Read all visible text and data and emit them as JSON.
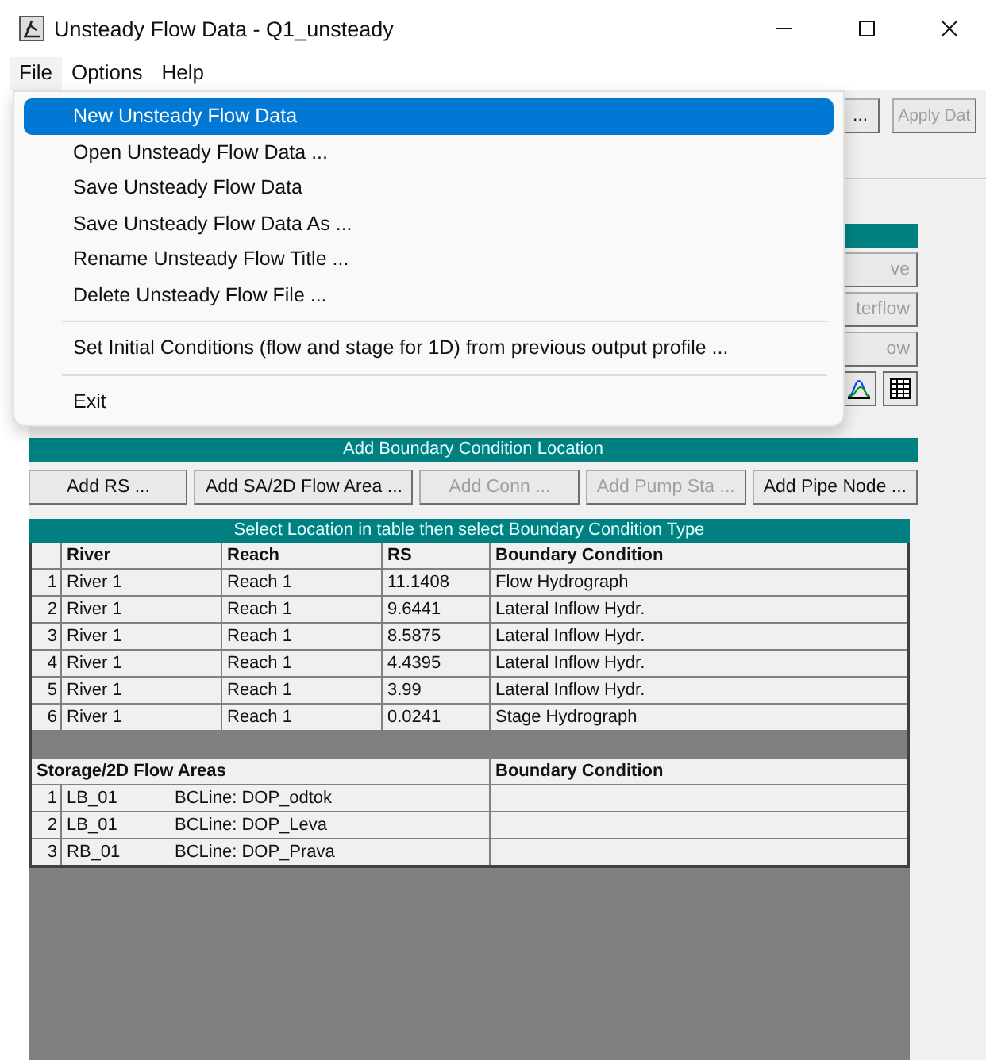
{
  "window": {
    "title": "Unsteady Flow Data - Q1_unsteady"
  },
  "menu_bar": [
    {
      "label": "File",
      "selected": true
    },
    {
      "label": "Options",
      "selected": false
    },
    {
      "label": "Help",
      "selected": false
    }
  ],
  "file_menu": [
    {
      "kind": "item",
      "label": "New Unsteady Flow Data",
      "selected": true
    },
    {
      "kind": "item",
      "label": "Open Unsteady Flow Data ...",
      "selected": false
    },
    {
      "kind": "item",
      "label": "Save Unsteady Flow Data",
      "selected": false
    },
    {
      "kind": "item",
      "label": "Save Unsteady Flow Data As ...",
      "selected": false
    },
    {
      "kind": "item",
      "label": "Rename Unsteady Flow Title ...",
      "selected": false
    },
    {
      "kind": "item",
      "label": "Delete Unsteady Flow File ...",
      "selected": false
    },
    {
      "kind": "separator"
    },
    {
      "kind": "item",
      "label": "Set Initial Conditions (flow and stage for 1D) from previous output profile ...",
      "selected": false
    },
    {
      "kind": "separator"
    },
    {
      "kind": "item",
      "label": "Exit",
      "selected": false
    }
  ],
  "toolbar_buttons": [
    {
      "label": "...",
      "disabled": false
    },
    {
      "label": "Apply Dat",
      "disabled": true
    }
  ],
  "side_buttons": [
    {
      "label": "ve",
      "disabled": true
    },
    {
      "label": "terflow",
      "disabled": true
    },
    {
      "label": "ow",
      "disabled": true
    }
  ],
  "boundary_location": {
    "title": "Add Boundary Condition Location",
    "buttons": [
      {
        "label": "Add RS ...",
        "disabled": false
      },
      {
        "label": "Add SA/2D Flow Area ...",
        "disabled": false
      },
      {
        "label": "Add Conn ...",
        "disabled": true
      },
      {
        "label": "Add Pump Sta ...",
        "disabled": true
      },
      {
        "label": "Add Pipe Node ...",
        "disabled": false
      }
    ]
  },
  "table": {
    "title": "Select Location in table then select Boundary Condition Type",
    "columns": [
      "River",
      "Reach",
      "RS",
      "Boundary Condition"
    ],
    "rows": [
      {
        "index": "1",
        "river": "River 1",
        "reach": "Reach 1",
        "rs": "11.1408",
        "bc": "Flow Hydrograph"
      },
      {
        "index": "2",
        "river": "River 1",
        "reach": "Reach 1",
        "rs": "9.6441",
        "bc": "Lateral Inflow Hydr."
      },
      {
        "index": "3",
        "river": "River 1",
        "reach": "Reach 1",
        "rs": "8.5875",
        "bc": "Lateral Inflow Hydr."
      },
      {
        "index": "4",
        "river": "River 1",
        "reach": "Reach 1",
        "rs": "4.4395",
        "bc": "Lateral Inflow Hydr."
      },
      {
        "index": "5",
        "river": "River 1",
        "reach": "Reach 1",
        "rs": "3.99",
        "bc": "Lateral Inflow Hydr."
      },
      {
        "index": "6",
        "river": "River 1",
        "reach": "Reach 1",
        "rs": "0.0241",
        "bc": "Stage Hydrograph"
      }
    ],
    "storage_columns": [
      "Storage/2D Flow Areas",
      "Boundary Condition"
    ],
    "storage_rows": [
      {
        "index": "1",
        "area": "LB_01",
        "line": "BCLine: DOP_odtok"
      },
      {
        "index": "2",
        "area": "LB_01",
        "line": "BCLine: DOP_Leva"
      },
      {
        "index": "3",
        "area": "RB_01",
        "line": "BCLine: DOP_Prava"
      }
    ]
  }
}
